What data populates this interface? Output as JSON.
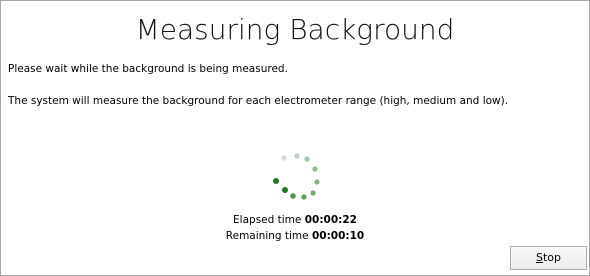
{
  "dialog": {
    "title": "Measuring Background",
    "message_line_1": "Please wait while the background is being measured.",
    "message_line_2": "The system will measure the background for each electrometer range (high, medium and low).",
    "elapsed_label": "Elapsed time",
    "elapsed_value": "00:00:22",
    "remaining_label": "Remaining time",
    "remaining_value": "00:00:10",
    "stop_button_label": "Stop",
    "stop_button_access_key": "S"
  },
  "spinner": {
    "icon": "busy-spinner-icon",
    "color": "#2e8b2e"
  }
}
